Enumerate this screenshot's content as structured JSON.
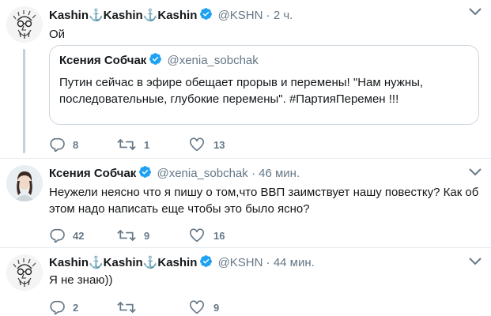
{
  "tweets": [
    {
      "name": "Kashin⚓Kashin⚓Kashin",
      "handle": "@KSHN",
      "dot": "·",
      "time": "2 ч.",
      "text": "Ой",
      "quote": {
        "name": "Ксения Собчак",
        "handle": "@xenia_sobchak",
        "text": "Путин сейчас в эфире обещает прорыв и перемены! \"Нам нужны, последовательные, глубокие перемены\". #ПартияПеремен !!!"
      },
      "replies": "8",
      "retweets": "1",
      "likes": "13"
    },
    {
      "name": "Ксения Собчак",
      "handle": "@xenia_sobchak",
      "dot": "·",
      "time": "46 мин.",
      "text": "Неужели неясно что я пишу о том,что ВВП заимствует нашу повестку? Как об этом надо написать еще чтобы это было ясно?",
      "replies": "42",
      "retweets": "9",
      "likes": "16"
    },
    {
      "name": "Kashin⚓Kashin⚓Kashin",
      "handle": "@KSHN",
      "dot": "·",
      "time": "44 мин.",
      "text": "Я не знаю))",
      "replies": "2",
      "retweets": "",
      "likes": "9"
    }
  ],
  "colors": {
    "text": "#14171a",
    "muted": "#657786",
    "verified": "#1da1f2",
    "border": "#ccd6dd",
    "thread": "#c4cfd6"
  },
  "icons": [
    "reply-icon",
    "retweet-icon",
    "like-icon",
    "verified-icon",
    "chevron-down-icon"
  ]
}
